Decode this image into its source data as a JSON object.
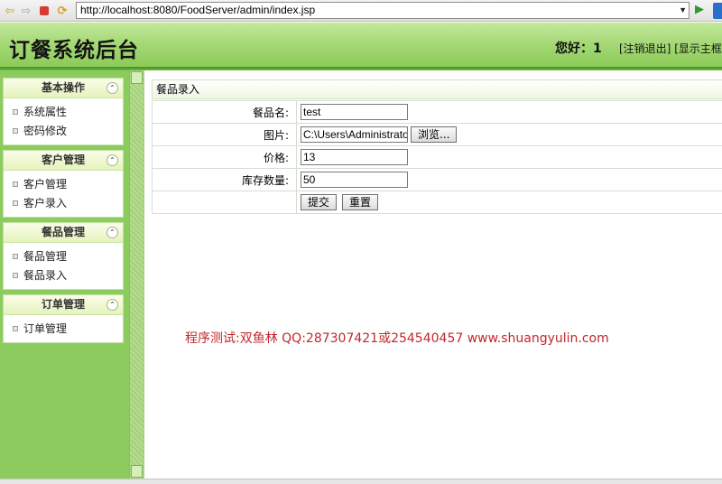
{
  "browser": {
    "url": "http://localhost:8080/FoodServer/admin/index.jsp",
    "icons": [
      "back-arrow-icon",
      "forward-arrow-icon",
      "stop-icon",
      "refresh-icon",
      "go-arrow-icon"
    ]
  },
  "header": {
    "title": "订餐系统后台",
    "greeting": "您好：1",
    "logout": "[注销退出]",
    "show_frame": "[显示主框架"
  },
  "sidebar": {
    "groups": [
      {
        "title": "基本操作",
        "items": [
          "系统属性",
          "密码修改"
        ]
      },
      {
        "title": "客户管理",
        "items": [
          "客户管理",
          "客户录入"
        ]
      },
      {
        "title": "餐品管理",
        "items": [
          "餐品管理",
          "餐品录入"
        ]
      },
      {
        "title": "订单管理",
        "items": [
          "订单管理"
        ]
      }
    ]
  },
  "content": {
    "panel_title": "餐品录入",
    "form": {
      "name_label": "餐品名:",
      "name_value": "test",
      "image_label": "图片:",
      "image_value": "C:\\Users\\Administrator\\",
      "browse_label": "浏览...",
      "price_label": "价格:",
      "price_value": "13",
      "stock_label": "库存数量:",
      "stock_value": "50",
      "submit_label": "提交",
      "reset_label": "重置"
    },
    "watermark": "程序测试:双鱼林 QQ:287307421或254540457 www.shuangyulin.com"
  },
  "colors": {
    "header_green": "#a6d978",
    "sidebar_green": "#8ccb5e",
    "watermark_red": "#c0282d"
  }
}
